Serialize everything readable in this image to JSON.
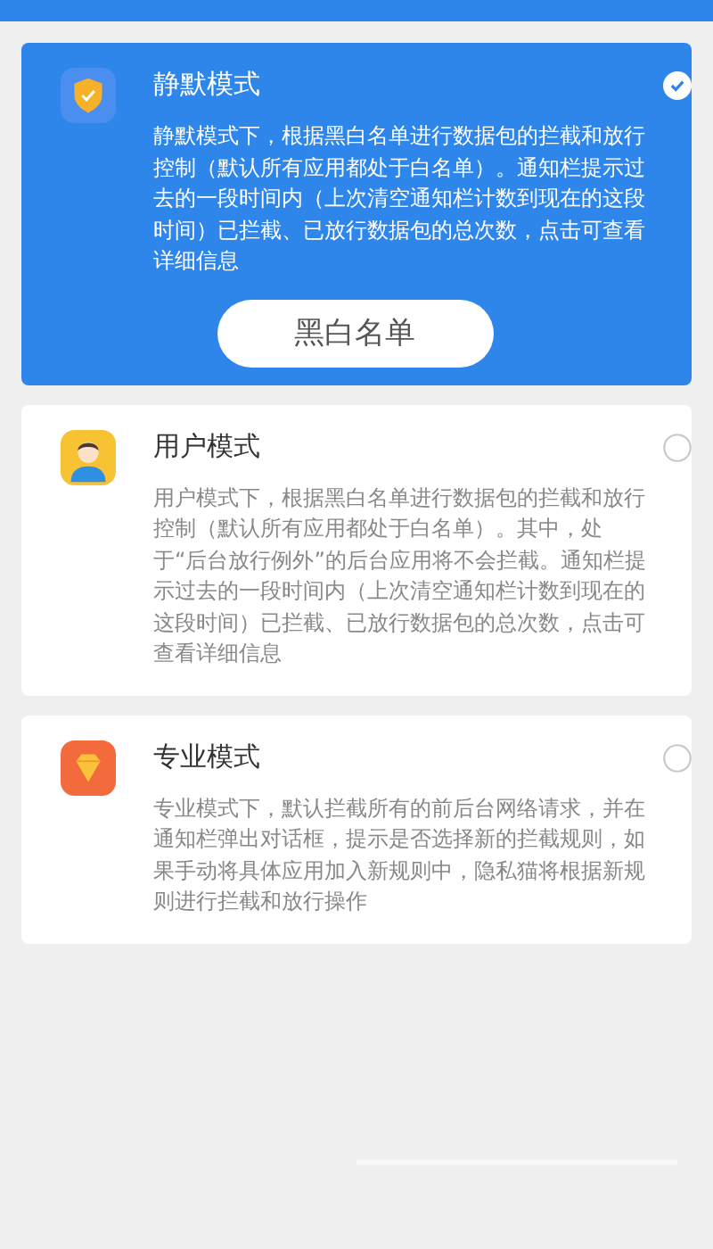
{
  "modes": [
    {
      "title": "静默模式",
      "description": "静默模式下，根据黑白名单进行数据包的拦截和放行控制（默认所有应用都处于白名单）。通知栏提示过去的一段时间内（上次清空通知栏计数到现在的这段时间）已拦截、已放行数据包的总次数，点击可查看详细信息",
      "selected": true,
      "button": "黑白名单"
    },
    {
      "title": "用户模式",
      "description": "用户模式下，根据黑白名单进行数据包的拦截和放行控制（默认所有应用都处于白名单）。其中，处于“后台放行例外”的后台应用将不会拦截。通知栏提示过去的一段时间内（上次清空通知栏计数到现在的这段时间）已拦截、已放行数据包的总次数，点击可查看详细信息",
      "selected": false
    },
    {
      "title": "专业模式",
      "description": "专业模式下，默认拦截所有的前后台网络请求，并在通知栏弹出对话框，提示是否选择新的拦截规则，如果手动将具体应用加入新规则中，隐私猫将根据新规则进行拦截和放行操作",
      "selected": false
    }
  ]
}
